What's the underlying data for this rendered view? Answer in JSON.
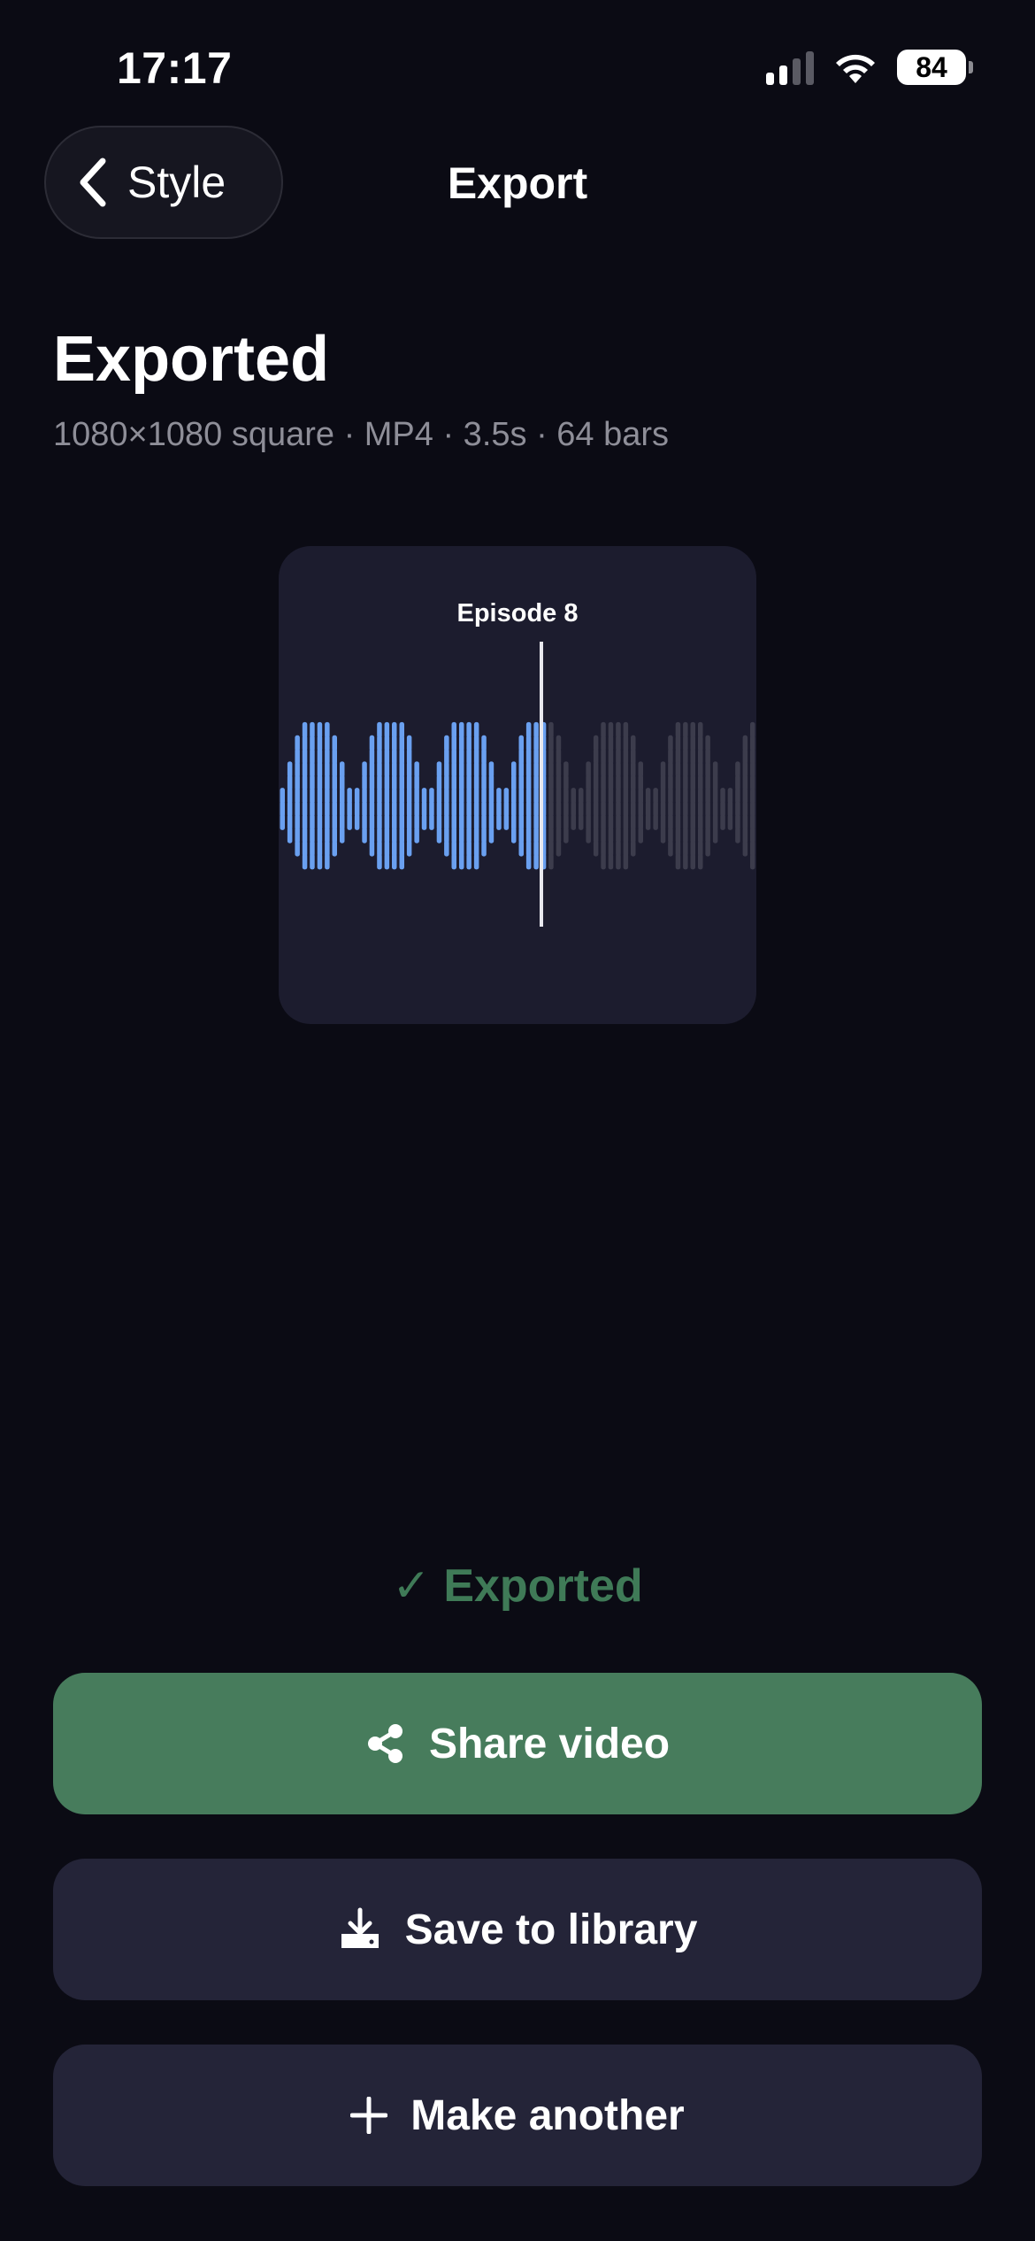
{
  "status_bar": {
    "time": "17:17",
    "battery": "84"
  },
  "nav": {
    "back_label": "Style",
    "title": "Export"
  },
  "header": {
    "title": "Exported",
    "subtitle": "1080×1080 square · MP4 · 3.5s · 64 bars"
  },
  "preview": {
    "title": "Episode 8",
    "bar_count": 64,
    "playhead_fraction": 0.55
  },
  "export_status": {
    "text": "✓ Exported",
    "color": "#3f7a57"
  },
  "actions": {
    "share_label": "Share video",
    "save_label": "Save to library",
    "new_label": "Make another"
  },
  "colors": {
    "background": "#0b0b14",
    "accent_green": "#477c5c",
    "secondary_button": "#242438",
    "wave_played": "#6aa0f0",
    "wave_unplayed": "#3c3c4c"
  }
}
